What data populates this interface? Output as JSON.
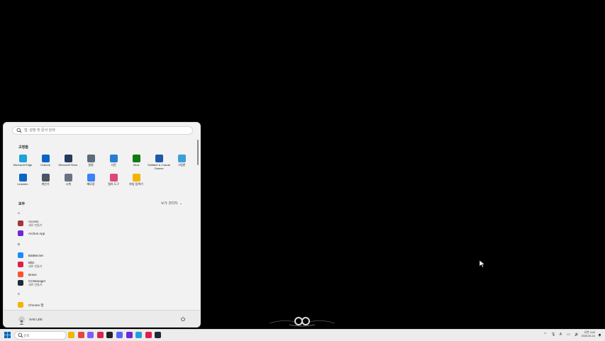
{
  "colors": {
    "menu_bg": "#f2f2f2",
    "taskbar_bg": "#ececec",
    "accent": "#0067c0"
  },
  "start_menu": {
    "search_placeholder": "앱, 설정 및 문서 검색",
    "pinned_title": "고정됨",
    "pinned": [
      {
        "label": "Microsoft Edge",
        "icon": "edge-icon",
        "color": "#1fa2d8"
      },
      {
        "label": "Outlook",
        "icon": "outlook-icon",
        "color": "#0a64c8"
      },
      {
        "label": "Microsoft Store",
        "icon": "store-icon",
        "color": "#243a5e"
      },
      {
        "label": "설정",
        "icon": "settings-gear-icon",
        "color": "#5a6b7a"
      },
      {
        "label": "사진",
        "icon": "photos-icon",
        "color": "#2a7bd4"
      },
      {
        "label": "Xbox",
        "icon": "xbox-icon",
        "color": "#107c10"
      },
      {
        "label": "Solitaire & Casual Games",
        "icon": "solitaire-icon",
        "color": "#1c5aa8"
      },
      {
        "label": "그림판",
        "icon": "paint-icon",
        "color": "#3aa0d8"
      },
      {
        "label": "LinkedIn",
        "icon": "linkedin-icon",
        "color": "#0a66c2"
      },
      {
        "label": "계산기",
        "icon": "calculator-icon",
        "color": "#4b5563"
      },
      {
        "label": "시계",
        "icon": "clock-icon",
        "color": "#6b7280"
      },
      {
        "label": "메모장",
        "icon": "notepad-icon",
        "color": "#3b82f6"
      },
      {
        "label": "캡처 도구",
        "icon": "snipping-tool-icon",
        "color": "#e0457b"
      },
      {
        "label": "파일 탐색기",
        "icon": "file-explorer-icon",
        "color": "#f2b400"
      }
    ],
    "all_title": "모두",
    "view_label": "보기: 관리자",
    "view_chevron": "⌄",
    "letters": [
      "A",
      "B",
      "C"
    ],
    "apps": [
      {
        "name": "Access",
        "sub": "새로 만들기",
        "icon": "access-icon",
        "color": "#a4373a"
      },
      {
        "name": "Archon App",
        "sub": "",
        "icon": "archon-icon",
        "color": "#6d28d9"
      },
      {
        "name": "BatBecnet",
        "sub": "",
        "icon": "battlenet-icon",
        "color": "#148eff"
      },
      {
        "name": "Blitz",
        "sub": "새로 만들기",
        "icon": "blitz-icon",
        "color": "#e11d48"
      },
      {
        "name": "Brave",
        "sub": "",
        "icon": "brave-icon",
        "color": "#fb542b"
      },
      {
        "name": "CCManager",
        "sub": "새로 만들기",
        "icon": "ccmanager-icon",
        "color": "#1e293b"
      },
      {
        "name": "Chrome 앱",
        "sub": "",
        "icon": "folder-icon",
        "color": "#f2b400"
      }
    ],
    "user_name": "SAE LEE",
    "power_label": "⏻"
  },
  "taskbar": {
    "search_placeholder": "검색",
    "apps": [
      {
        "name": "file-explorer-taskbar",
        "color": "#f2b400"
      },
      {
        "name": "chrome-taskbar",
        "color": "#e8453c"
      },
      {
        "name": "copilot-taskbar",
        "color": "#7c5cff"
      },
      {
        "name": "app-red-taskbar",
        "color": "#d6264c"
      },
      {
        "name": "app-dark-taskbar",
        "color": "#222222"
      },
      {
        "name": "discord-taskbar",
        "color": "#5865f2"
      },
      {
        "name": "archon-taskbar",
        "color": "#6d28d9"
      },
      {
        "name": "edge-taskbar",
        "color": "#1fa2d8"
      },
      {
        "name": "app-pink-taskbar",
        "color": "#e11d48"
      },
      {
        "name": "terminal-taskbar",
        "color": "#1f2937"
      }
    ],
    "tray_chevron": "^",
    "tray_keyboard": "A",
    "clock_time": "오전 3:42",
    "clock_date": "2026-06-14"
  }
}
